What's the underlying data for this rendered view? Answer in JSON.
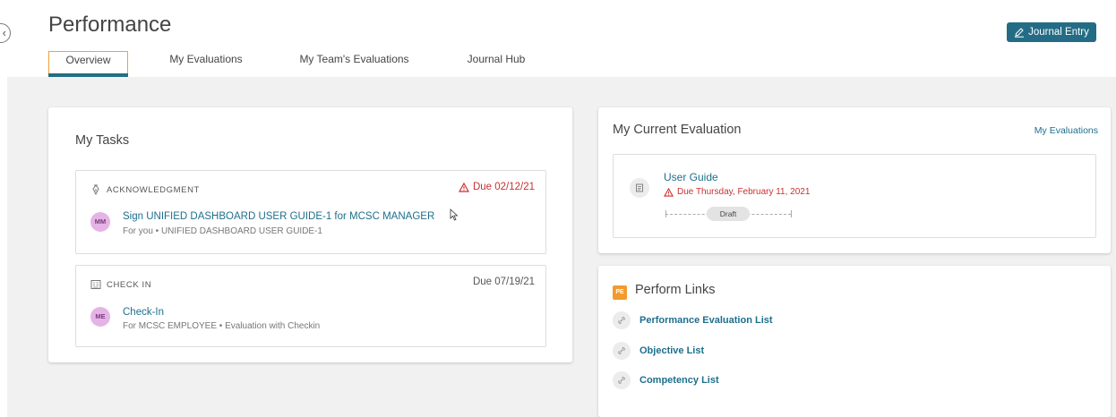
{
  "header": {
    "title": "Performance",
    "journal_entry_label": "Journal Entry",
    "collapse_glyph": "‹"
  },
  "tabs": [
    {
      "label": "Overview",
      "active": true
    },
    {
      "label": "My Evaluations",
      "active": false
    },
    {
      "label": "My Team's Evaluations",
      "active": false
    },
    {
      "label": "Journal Hub",
      "active": false
    }
  ],
  "tasks": {
    "title": "My Tasks",
    "items": [
      {
        "type": "ACKNOWLEDGMENT",
        "type_icon": "pen-nib-icon",
        "due": "Due 02/12/21",
        "overdue": true,
        "avatar": "MM",
        "link": "Sign UNIFIED DASHBOARD USER GUIDE-1 for MCSC MANAGER",
        "subtitle": "For you • UNIFIED DASHBOARD USER GUIDE-1"
      },
      {
        "type": "CHECK IN",
        "type_icon": "checklist-icon",
        "due": "Due 07/19/21",
        "overdue": false,
        "avatar": "ME",
        "link": "Check-In",
        "subtitle": "For MCSC EMPLOYEE • Evaluation with Checkin"
      }
    ]
  },
  "current_evaluation": {
    "title": "My Current Evaluation",
    "link": "My Evaluations",
    "name": "User Guide",
    "due": "Due Thursday, February 11, 2021",
    "status": "Draft"
  },
  "perform_links": {
    "badge": "PE",
    "title": "Perform Links",
    "items": [
      {
        "label": "Performance Evaluation List"
      },
      {
        "label": "Objective List"
      },
      {
        "label": "Competency List"
      }
    ]
  },
  "colors": {
    "accent": "#246c86",
    "link": "#1e6f8c",
    "overdue": "#c8312f",
    "tab_focus": "#f0a23a",
    "pe_badge": "#f29a2e"
  }
}
